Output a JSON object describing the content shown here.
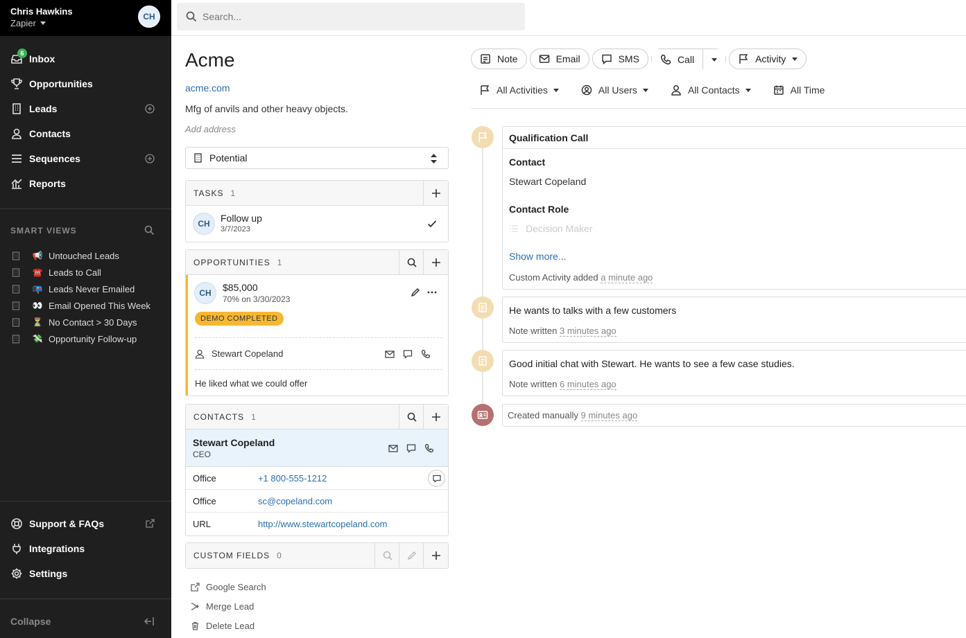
{
  "user": {
    "name": "Chris Hawkins",
    "org": "Zapier",
    "initials": "CH"
  },
  "nav": {
    "inbox": "Inbox",
    "inbox_badge": "6",
    "opportunities": "Opportunities",
    "leads": "Leads",
    "contacts": "Contacts",
    "sequences": "Sequences",
    "reports": "Reports"
  },
  "smart_views": {
    "heading": "SMART VIEWS",
    "items": [
      {
        "emoji": "📢",
        "label": "Untouched Leads"
      },
      {
        "emoji": "☎️",
        "label": "Leads to Call"
      },
      {
        "emoji": "📭",
        "label": "Leads Never Emailed"
      },
      {
        "emoji": "👀",
        "label": "Email Opened This Week"
      },
      {
        "emoji": "⏳",
        "label": "No Contact > 30 Days"
      },
      {
        "emoji": "💸",
        "label": "Opportunity Follow-up"
      }
    ]
  },
  "bottom_nav": {
    "support": "Support & FAQs",
    "integrations": "Integrations",
    "settings": "Settings",
    "collapse": "Collapse"
  },
  "search": {
    "placeholder": "Search..."
  },
  "lead": {
    "name": "Acme",
    "url": "acme.com",
    "description": "Mfg of anvils and other heavy objects.",
    "address_placeholder": "Add address",
    "status": "Potential"
  },
  "tasks": {
    "heading": "TASKS",
    "count": "1",
    "items": [
      {
        "initials": "CH",
        "title": "Follow up",
        "date": "3/7/2023"
      }
    ]
  },
  "opportunities": {
    "heading": "OPPORTUNITIES",
    "count": "1",
    "item": {
      "initials": "CH",
      "amount": "$85,000",
      "detail": "70% on 3/30/2023",
      "status": "DEMO COMPLETED",
      "contact": "Stewart Copeland",
      "note": "He liked what we could offer"
    }
  },
  "contacts": {
    "heading": "CONTACTS",
    "count": "1",
    "item": {
      "name": "Stewart Copeland",
      "title": "CEO",
      "rows": [
        {
          "label": "Office",
          "value": "+1 800-555-1212"
        },
        {
          "label": "Office",
          "value": "sc@copeland.com"
        },
        {
          "label": "URL",
          "value": "http://www.stewartcopeland.com"
        }
      ]
    }
  },
  "custom_fields": {
    "heading": "CUSTOM FIELDS",
    "count": "0"
  },
  "extra_links": {
    "google": "Google Search",
    "merge": "Merge Lead",
    "delete": "Delete Lead"
  },
  "actions": {
    "note": "Note",
    "email": "Email",
    "sms": "SMS",
    "call": "Call",
    "activity": "Activity"
  },
  "filters": {
    "activities": "All Activities",
    "users": "All Users",
    "contacts": "All Contacts",
    "time": "All Time"
  },
  "timeline": {
    "qualification": {
      "title": "Qualification Call",
      "contact_label": "Contact",
      "contact_value": "Stewart Copeland",
      "role_label": "Contact Role",
      "role_value": "Decision Maker",
      "show_more": "Show more...",
      "meta": "Custom Activity added",
      "ago": "a minute ago"
    },
    "note1": {
      "text": "He wants to talks with a few customers",
      "meta": "Note written",
      "ago": "3 minutes ago"
    },
    "note2": {
      "text": "Good initial chat with Stewart. He wants to see a few case studies.",
      "meta": "Note written",
      "ago": "6 minutes ago"
    },
    "created": {
      "meta": "Created manually",
      "ago": "9 minutes ago"
    }
  },
  "colors": {
    "accent_link": "#2a6fb0",
    "badge_green": "#3fae5c",
    "opp_status": "#f7b731",
    "timeline_icon": "#f2ddb2",
    "created_icon": "#b5716f"
  }
}
